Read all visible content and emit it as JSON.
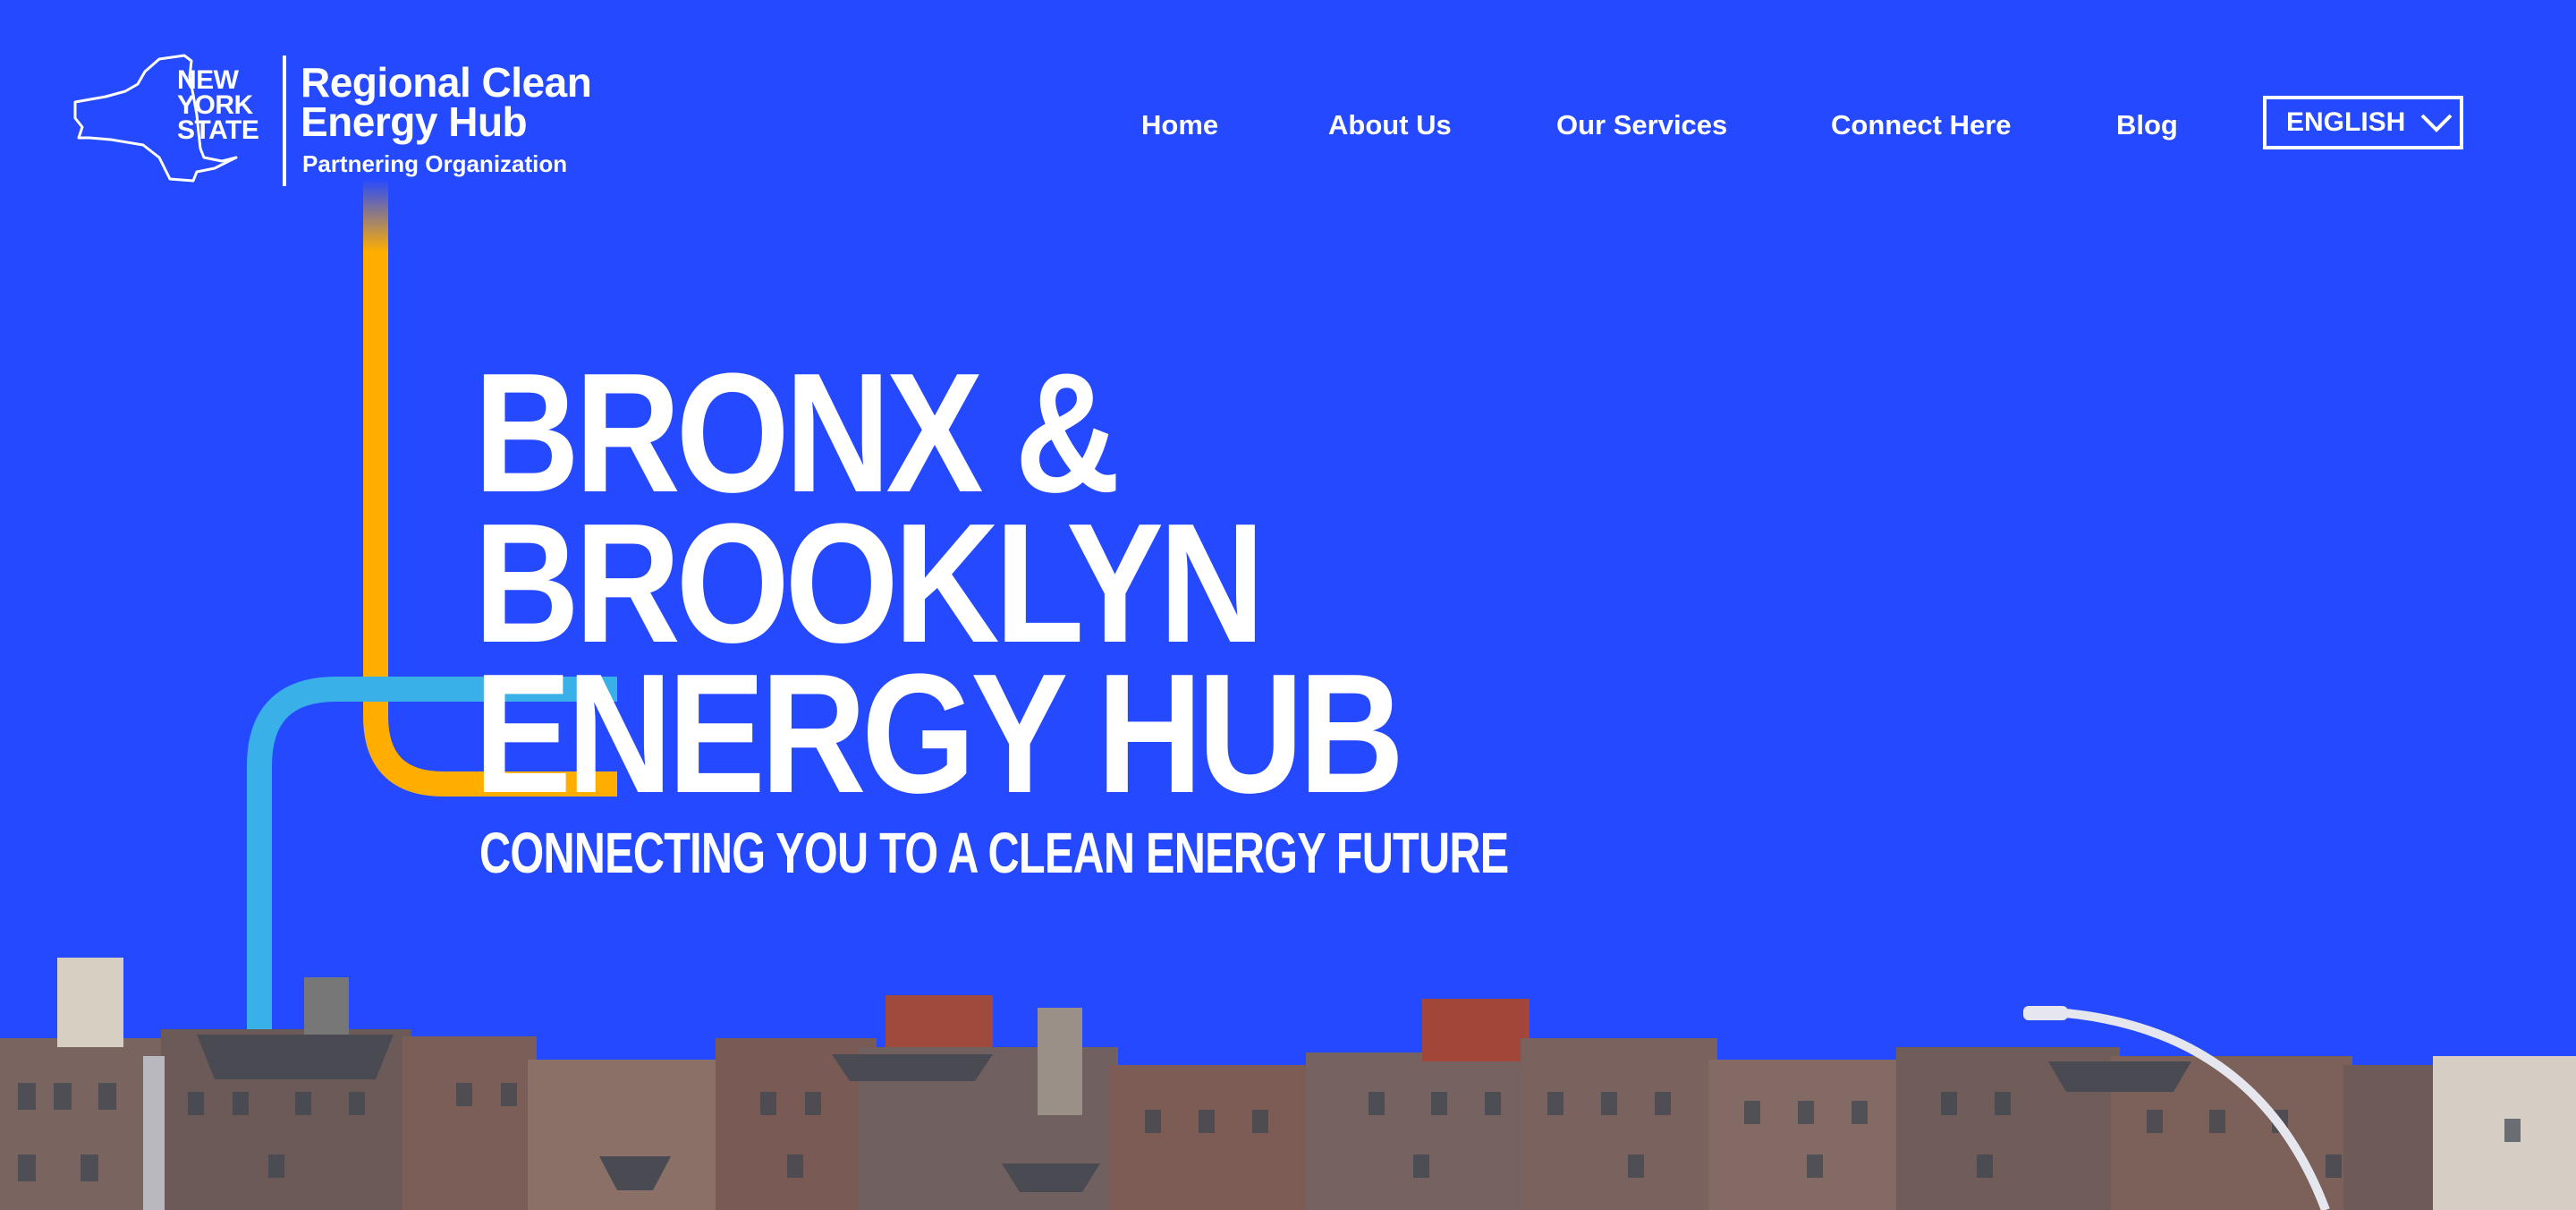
{
  "logo": {
    "state_lines": [
      "NEW",
      "YORK",
      "STATE"
    ],
    "hub_title_lines": [
      "Regional Clean",
      "Energy Hub"
    ],
    "hub_subtitle": "Partnering Organization"
  },
  "nav": {
    "items": [
      {
        "label": "Home"
      },
      {
        "label": "About Us"
      },
      {
        "label": "Our Services"
      },
      {
        "label": "Connect Here"
      },
      {
        "label": "Blog"
      }
    ],
    "language": {
      "selected": "ENGLISH"
    }
  },
  "hero": {
    "title_lines": [
      "BRONX &",
      "BROOKLYN",
      "ENERGY HUB"
    ],
    "tagline": "CONNECTING YOU TO A CLEAN ENERGY FUTURE"
  },
  "colors": {
    "background": "#2549FF",
    "line_orange": "#FFAE00",
    "line_cyan": "#3AB0E8",
    "line_pink": "#FF55E8",
    "text": "#FFFFFF"
  },
  "icons": {
    "logo": "new-york-state-map-icon",
    "dropdown": "chevron-down-icon"
  }
}
